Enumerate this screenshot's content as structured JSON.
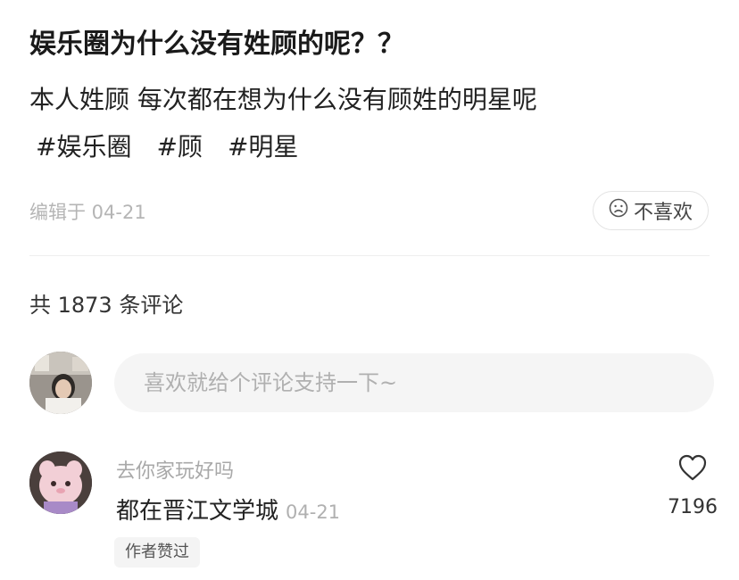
{
  "post": {
    "title": "娱乐圈为什么没有姓顾的呢？？",
    "body": "本人姓顾 每次都在想为什么没有顾姓的明星呢",
    "tags": [
      "#娱乐圈",
      "#顾",
      "#明星"
    ],
    "edited": "编辑于 04-21",
    "dislike_label": "不喜欢"
  },
  "comments_section": {
    "count_text": "共 1873 条评论",
    "input_placeholder": "喜欢就给个评论支持一下~"
  },
  "comment": {
    "username": "去你家玩好吗",
    "text": "都在晋江文学城",
    "date": "04-21",
    "badge": "作者赞过",
    "like_count": "7196"
  },
  "icons": {
    "dislike": "sad-face-icon",
    "like": "heart-outline-icon"
  }
}
